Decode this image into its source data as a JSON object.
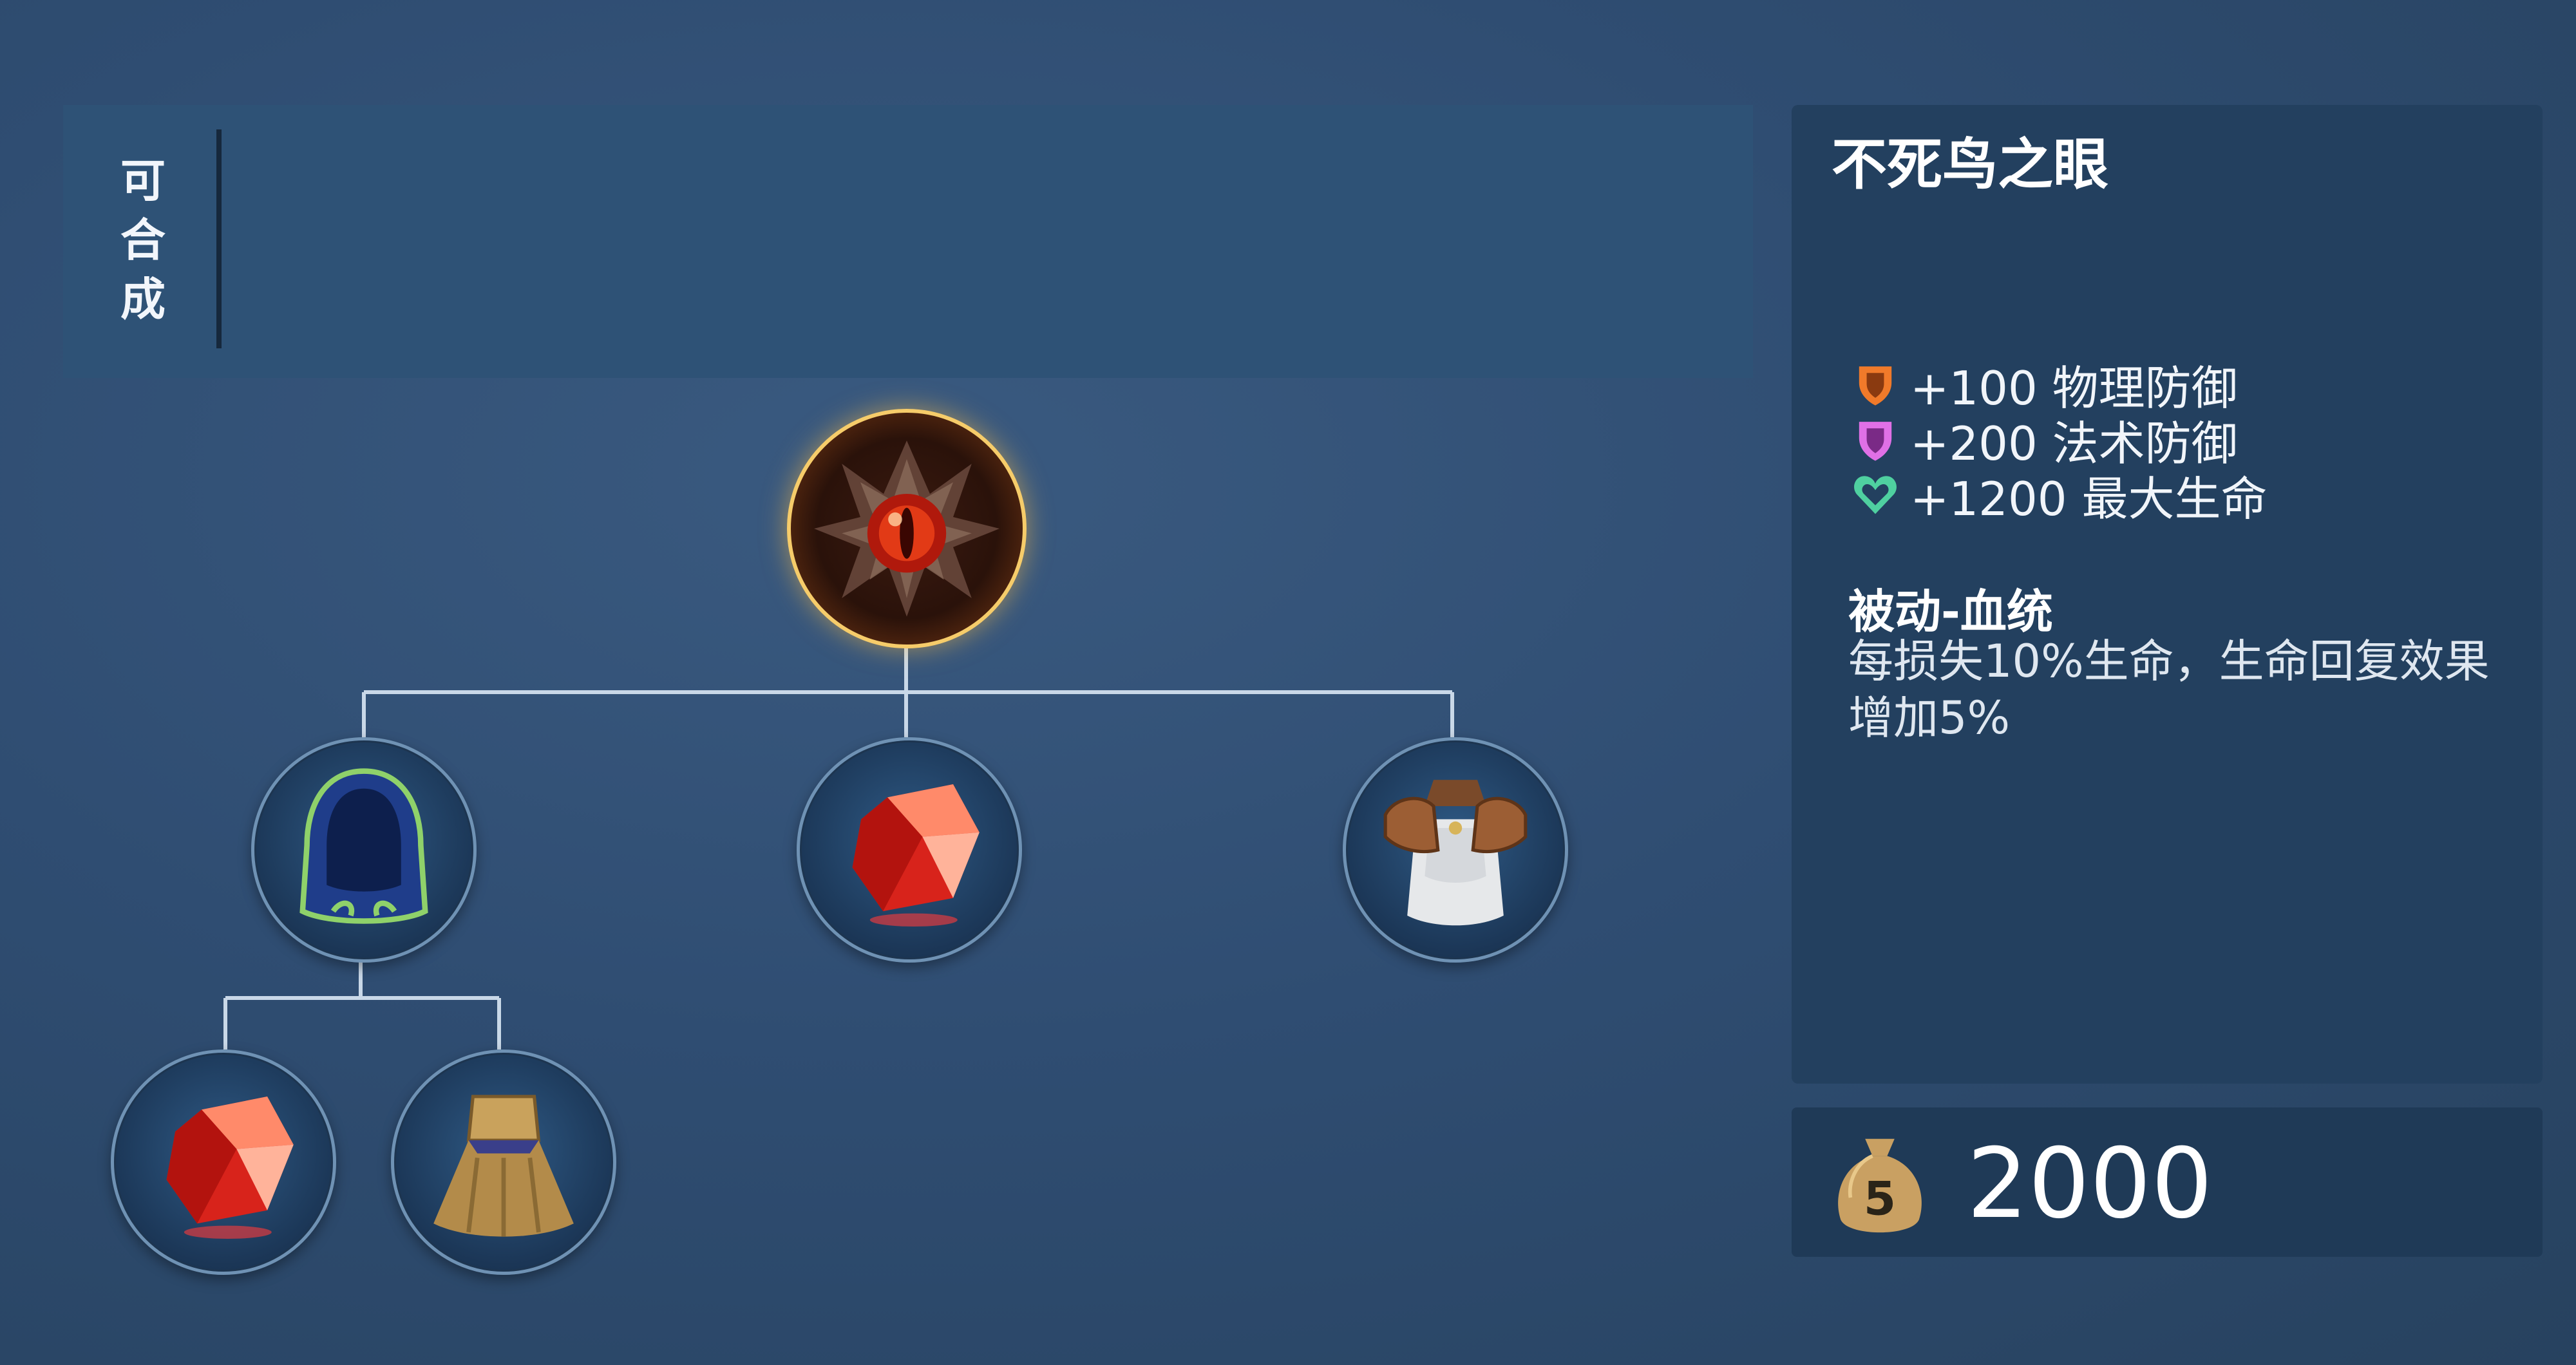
{
  "craft_section": {
    "label": "可\n合\n成"
  },
  "item": {
    "name": "不死鸟之眼",
    "stats": [
      {
        "icon": "physical-defense-shield-icon",
        "color": "#f07a2a",
        "text": "+100 物理防御"
      },
      {
        "icon": "magic-defense-shield-icon",
        "color": "#e070e6",
        "text": "+200 法术防御"
      },
      {
        "icon": "max-health-heart-icon",
        "color": "#4fd0a0",
        "text": "+1200 最大生命"
      }
    ],
    "passive_title": "被动-血统",
    "passive_desc": "每损失10%生命，生命回复效果增加5%"
  },
  "price": {
    "icon": "gold-money-bag-icon",
    "value": "2000"
  },
  "recipe_tree": {
    "root": {
      "icon": "phoenix-eye-item-icon"
    },
    "components": [
      {
        "icon": "blue-hooded-cloak-icon"
      },
      {
        "icon": "red-crystal-icon"
      },
      {
        "icon": "leather-armor-vest-icon"
      }
    ],
    "sub_components": [
      {
        "icon": "red-crystal-icon"
      },
      {
        "icon": "golden-cape-icon"
      }
    ]
  },
  "colors": {
    "background": "#2f4d72",
    "panel": "#23405f",
    "connector": "#c9d8e8",
    "gold": "#f6cc6a"
  }
}
